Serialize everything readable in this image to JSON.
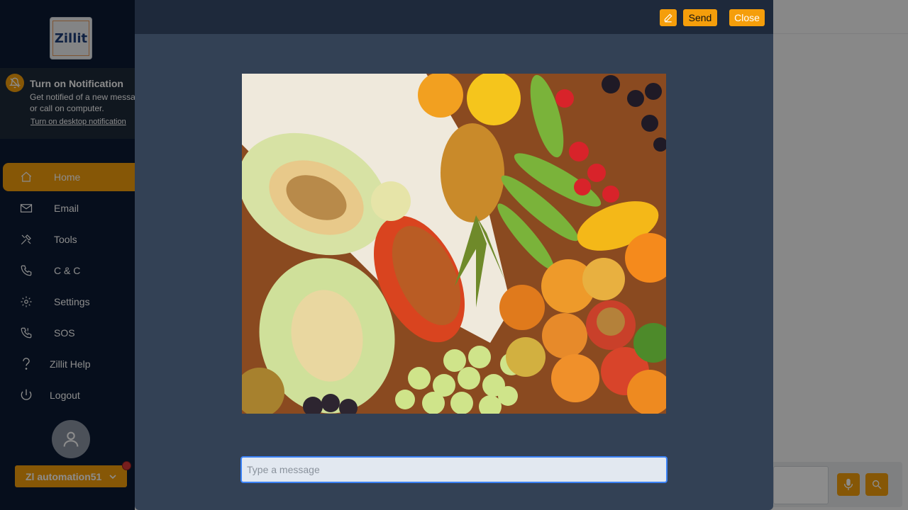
{
  "app": {
    "logo_text": "Zillit"
  },
  "notification": {
    "title": "Turn on Notification",
    "line1": "Get notified of a new message",
    "line2": "or call on computer.",
    "link": "Turn on desktop notification",
    "icon": "bell-off-icon"
  },
  "sidebar": {
    "items": [
      {
        "label": "Home",
        "icon": "home-icon",
        "active": true
      },
      {
        "label": "Email",
        "icon": "mail-icon"
      },
      {
        "label": "Tools",
        "icon": "tools-icon"
      },
      {
        "label": "C & C",
        "icon": "phone-icon"
      },
      {
        "label": "Settings",
        "icon": "gear-icon"
      },
      {
        "label": "SOS",
        "icon": "phone-alert-icon"
      },
      {
        "label": "Zillit Help",
        "icon": "question-icon"
      },
      {
        "label": "Logout",
        "icon": "power-icon"
      }
    ]
  },
  "user": {
    "name": "Zl automation51",
    "avatar_icon": "user-icon"
  },
  "modal": {
    "send_label": "Send",
    "close_label": "Close",
    "edit_icon": "pencil-icon",
    "image_alt": "fruit assortment",
    "message_placeholder": "Type a message",
    "message_value": ""
  },
  "colors": {
    "accent": "#f59e0b",
    "sidebar_bg": "#0c1b33",
    "modal_bg": "#334155",
    "modal_header_bg": "#1e293b",
    "input_focus": "#3b82f6"
  }
}
